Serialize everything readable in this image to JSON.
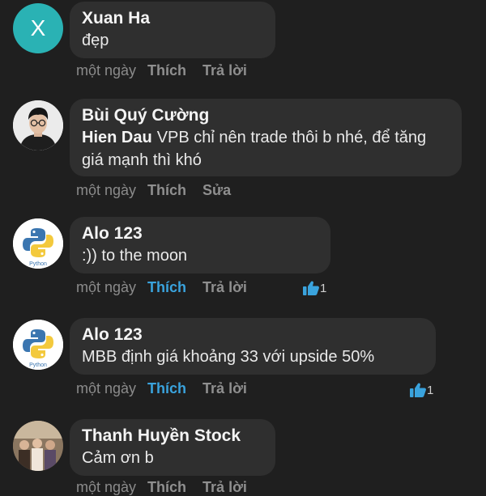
{
  "comments": [
    {
      "author": "Xuan Ha",
      "avatar_letter": "X",
      "text": "đẹp",
      "time": "một ngày",
      "like": "Thích",
      "reply": "Trả lời"
    },
    {
      "author": "Bùi Quý Cường",
      "mention": "Hien Dau",
      "text": "VPB chỉ nên trade thôi b nhé, để tăng giá mạnh thì khó",
      "time": "một ngày",
      "like": "Thích",
      "reply": "Sửa"
    },
    {
      "author": "Alo 123",
      "avatar_label": "Python",
      "text": ":)) to the moon",
      "time": "một ngày",
      "like": "Thích",
      "reply": "Trả lời",
      "reaction_count": "1"
    },
    {
      "author": "Alo 123",
      "avatar_label": "Python",
      "text": "MBB định giá khoảng 33 với upside 50%",
      "time": "một ngày",
      "like": "Thích",
      "reply": "Trả lời",
      "reaction_count": "1"
    },
    {
      "author": "Thanh Huyền Stock",
      "text": "Cảm ơn b",
      "time": "một ngày",
      "like": "Thích",
      "reply": "Trả lời"
    }
  ],
  "colors": {
    "background": "#1f1f1f",
    "bubble": "#2f2f2f",
    "like_active": "#3aa3dd",
    "avatar_x": "#2ab2b4"
  }
}
